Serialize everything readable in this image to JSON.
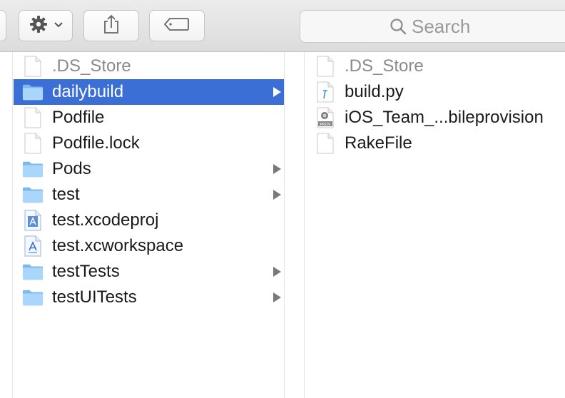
{
  "toolbar": {
    "actions_button": {
      "icon": "gear-icon",
      "dropdown_icon": "chevron-down-icon"
    },
    "share_button": {
      "icon": "share-icon"
    },
    "tags_button": {
      "icon": "tag-icon"
    },
    "search": {
      "placeholder": "Search",
      "icon": "magnifier-icon"
    }
  },
  "column1": {
    "items": [
      {
        "name": ".DS_Store",
        "kind": "document",
        "dimmed": true,
        "has_children": false
      },
      {
        "name": "dailybuild",
        "kind": "folder",
        "selected": true,
        "has_children": true
      },
      {
        "name": "Podfile",
        "kind": "document",
        "has_children": false
      },
      {
        "name": "Podfile.lock",
        "kind": "document",
        "has_children": false
      },
      {
        "name": "Pods",
        "kind": "folder",
        "has_children": true
      },
      {
        "name": "test",
        "kind": "folder",
        "has_children": true
      },
      {
        "name": "test.xcodeproj",
        "kind": "xcodeproj",
        "has_children": false
      },
      {
        "name": "test.xcworkspace",
        "kind": "xcworkspace",
        "has_children": false
      },
      {
        "name": "testTests",
        "kind": "folder",
        "has_children": true
      },
      {
        "name": "testUITests",
        "kind": "folder",
        "has_children": true
      }
    ]
  },
  "column2": {
    "items": [
      {
        "name": ".DS_Store",
        "kind": "document",
        "dimmed": true
      },
      {
        "name": "build.py",
        "kind": "python"
      },
      {
        "name": "iOS_Team_...bileprovision",
        "kind": "provision",
        "badge": "PROV"
      },
      {
        "name": "RakeFile",
        "kind": "document"
      }
    ]
  },
  "colors": {
    "selection": "#3b6fd6",
    "folder": "#8cc6f5",
    "disclosure": "#7a7a7a"
  }
}
